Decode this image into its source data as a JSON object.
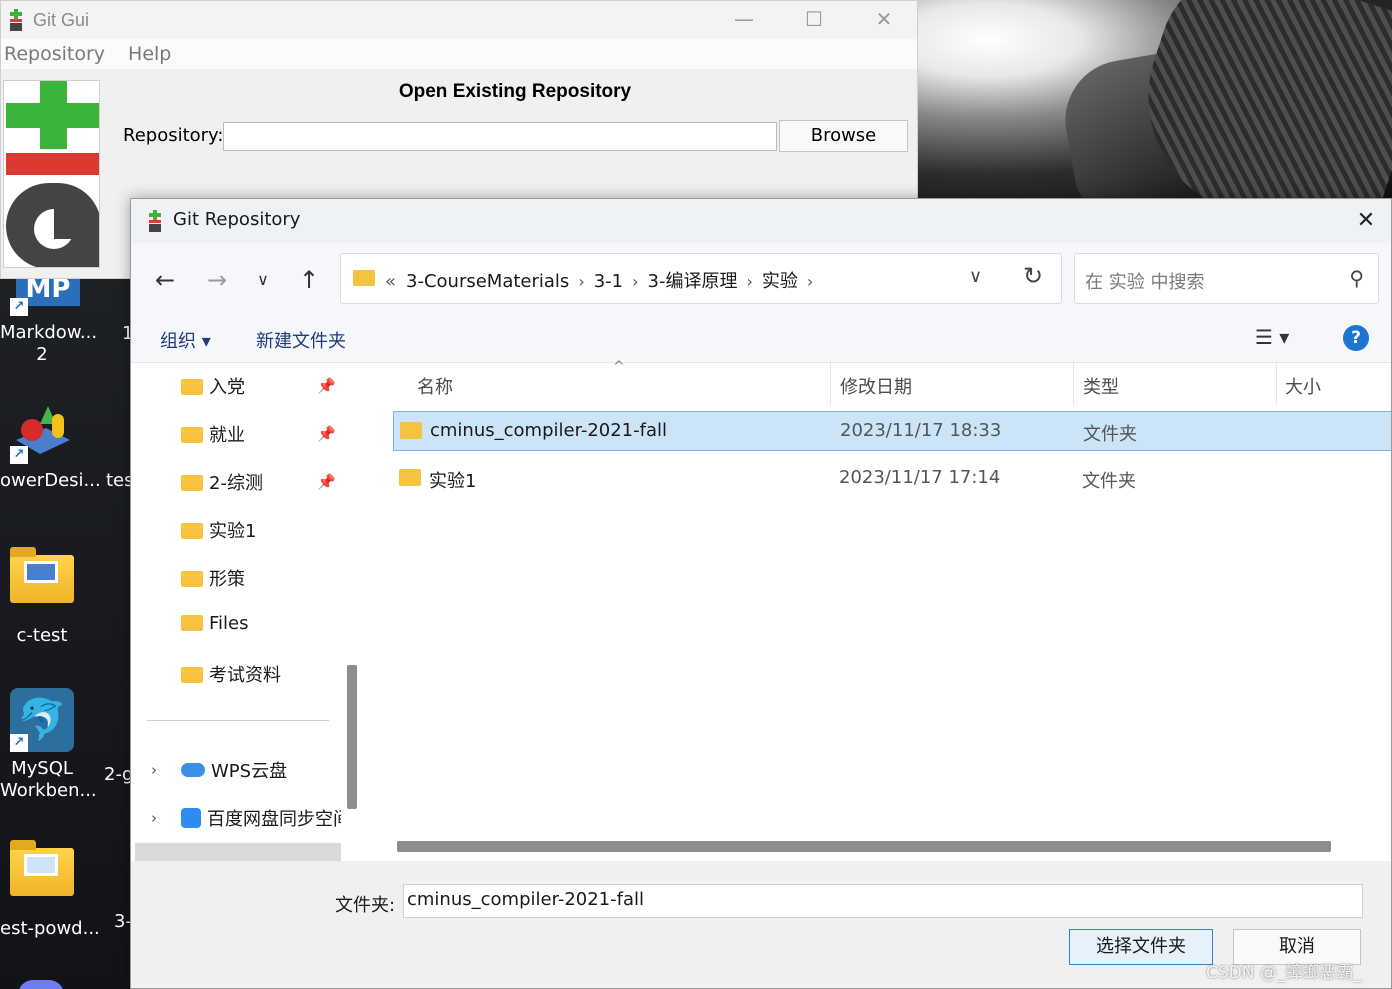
{
  "desktop": {
    "icons": [
      {
        "label1": "Markdow...",
        "label2": "2"
      },
      {
        "label1": "owerDesi..."
      },
      {
        "label1": "c-test"
      },
      {
        "label1": "MySQL",
        "label2": "Workben..."
      },
      {
        "label1": "est-powd..."
      }
    ],
    "second_col": [
      "1",
      "tes",
      "2-g",
      "3-"
    ]
  },
  "gitgui": {
    "title": "Git Gui",
    "menu": [
      "Repository",
      "Help"
    ],
    "heading": "Open Existing Repository",
    "repo_label": "Repository:",
    "repo_value": "",
    "browse_label": "Browse"
  },
  "dialog": {
    "title": "Git Repository",
    "breadcrumb": [
      "«",
      "3-CourseMaterials",
      "3-1",
      "3-编译原理",
      "实验"
    ],
    "search_placeholder": "在 实验 中搜索",
    "toolbar": {
      "organize": "组织 ▾",
      "new_folder": "新建文件夹"
    },
    "nav_items": [
      "入党",
      "就业",
      "2-综测",
      "实验1",
      "形策",
      "Files",
      "考试资料"
    ],
    "nav_tree": [
      "WPS云盘",
      "百度网盘同步空间"
    ],
    "columns": [
      "名称",
      "修改日期",
      "类型",
      "大小"
    ],
    "files": [
      {
        "name": "cminus_compiler-2021-fall",
        "date": "2023/11/17 18:33",
        "type": "文件夹",
        "selected": true
      },
      {
        "name": "实验1",
        "date": "2023/11/17 17:14",
        "type": "文件夹",
        "selected": false
      }
    ],
    "folder_label": "文件夹:",
    "folder_value": "cminus_compiler-2021-fall",
    "ok_label": "选择文件夹",
    "cancel_label": "取消"
  },
  "watermark": "CSDN @_蟑螂恶霸_"
}
